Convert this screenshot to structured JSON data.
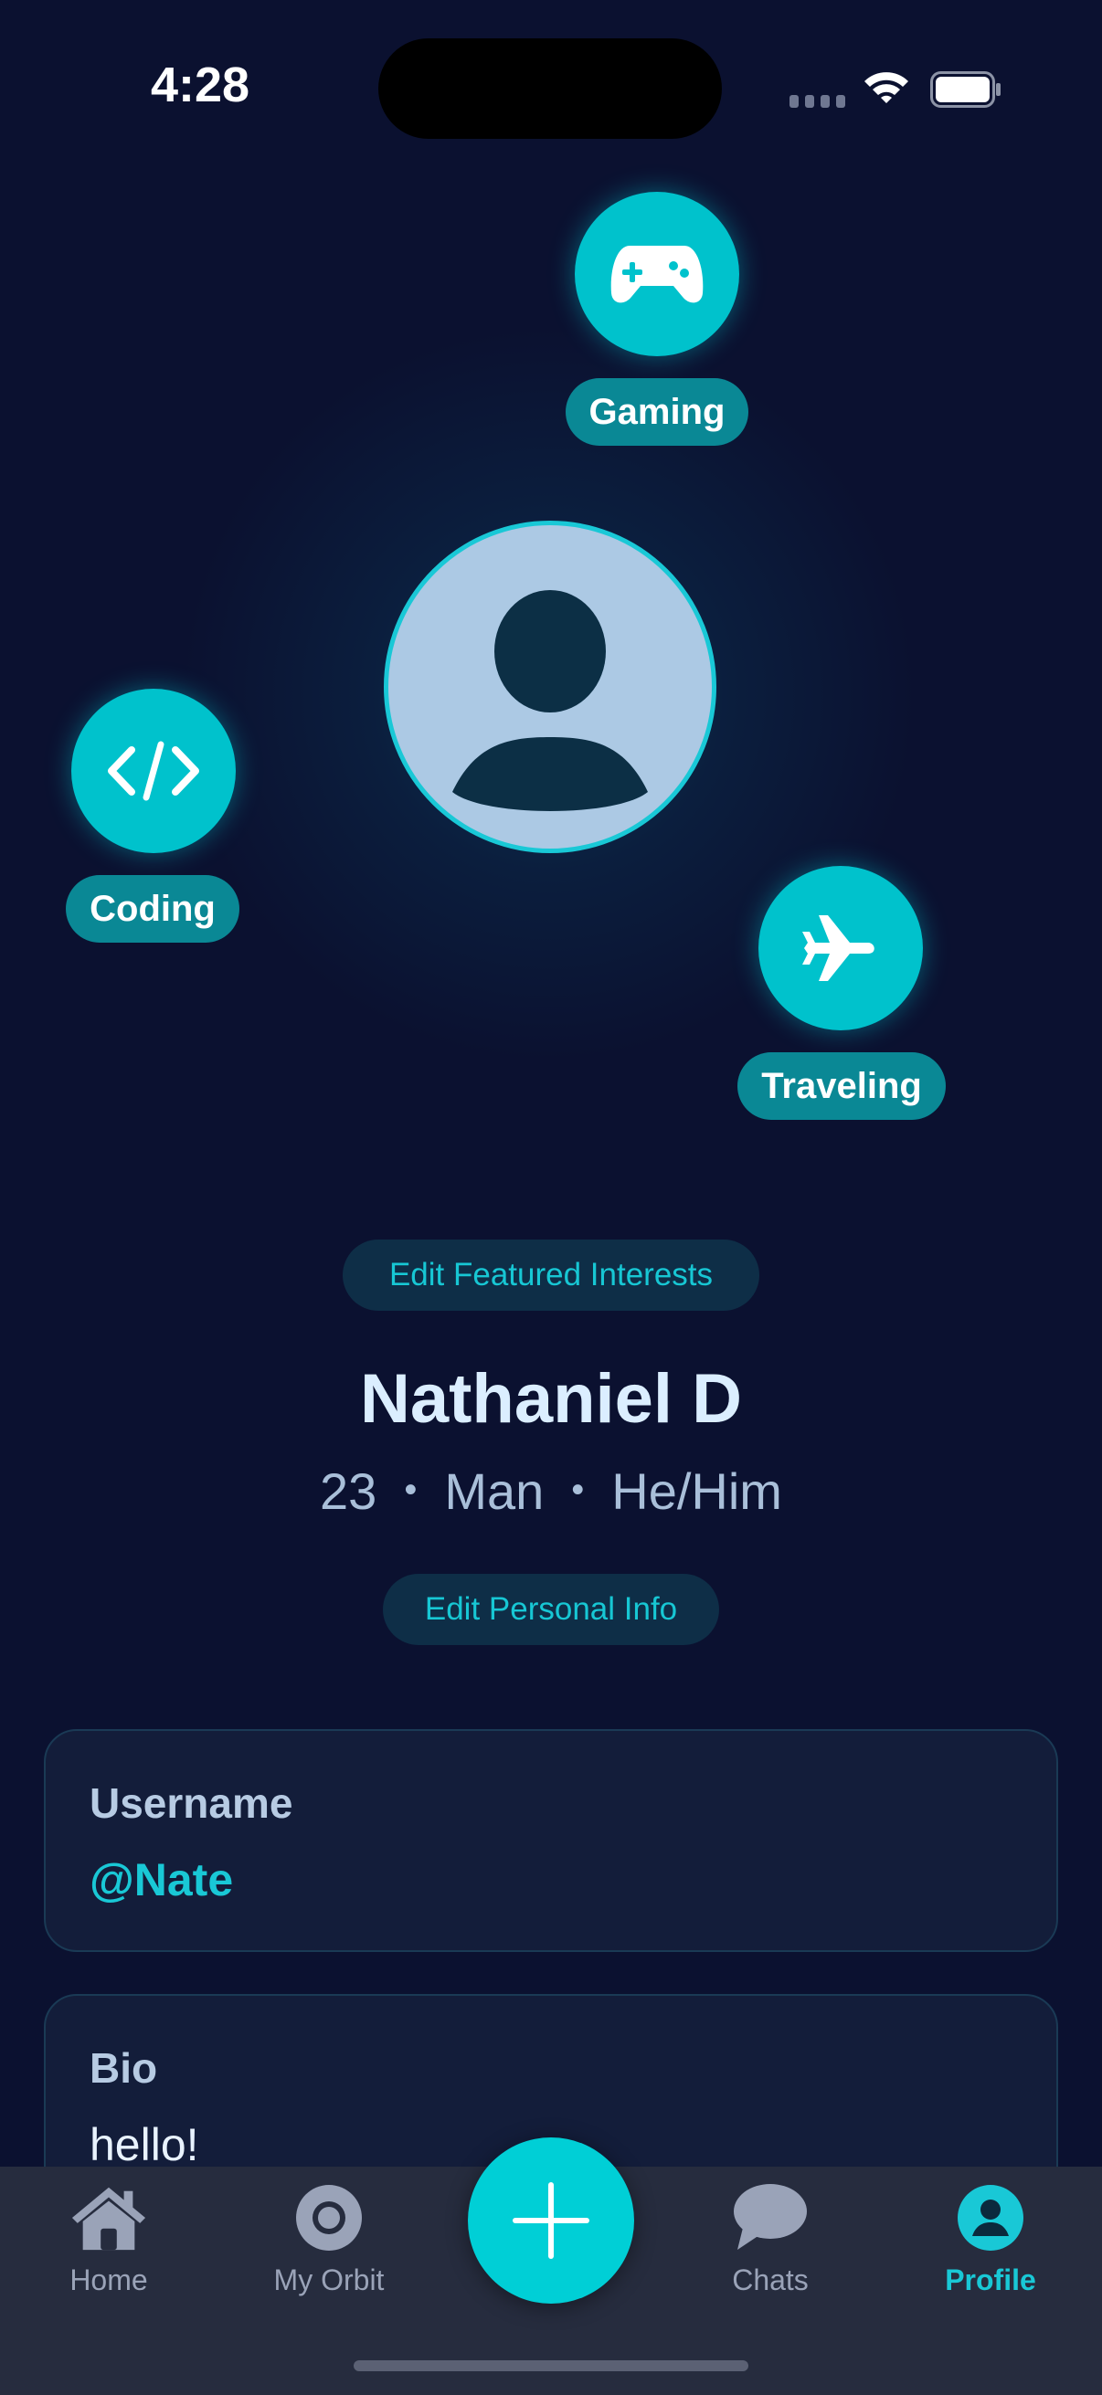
{
  "status_bar": {
    "time": "4:28"
  },
  "interests": [
    {
      "label": "Gaming",
      "icon": "gamepad-icon"
    },
    {
      "label": "Coding",
      "icon": "code-icon"
    },
    {
      "label": "Traveling",
      "icon": "airplane-icon"
    }
  ],
  "profile": {
    "edit_interests_label": "Edit Featured Interests",
    "name": "Nathaniel D",
    "age": "23",
    "gender": "Man",
    "pronouns": "He/Him",
    "separator": "•",
    "edit_info_label": "Edit Personal Info"
  },
  "username_card": {
    "label": "Username",
    "value": "@Nate"
  },
  "bio_card": {
    "label": "Bio",
    "value": "hello!"
  },
  "tabbar": {
    "home": "Home",
    "orbit": "My Orbit",
    "chats": "Chats",
    "profile": "Profile"
  },
  "colors": {
    "background": "#0b1130",
    "accent": "#00c2cc",
    "chip": "#0a8895",
    "username": "#19c8d6"
  }
}
